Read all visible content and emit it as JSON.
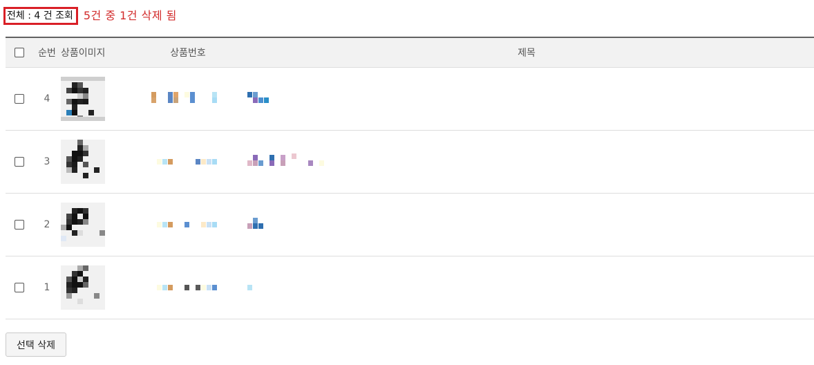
{
  "summary": {
    "total_label": "전체 : 4 건 조회",
    "delete_notice": "5건 중 1건 삭제 됨"
  },
  "table": {
    "headers": {
      "checkbox": "",
      "seq": "순번",
      "image": "상품이미지",
      "product_no": "상품번호",
      "title": "제목"
    },
    "rows": [
      {
        "seq": "4",
        "product_no": "",
        "title": ""
      },
      {
        "seq": "3",
        "product_no": "",
        "title": ""
      },
      {
        "seq": "2",
        "product_no": "",
        "title": ""
      },
      {
        "seq": "1",
        "product_no": "",
        "title": ""
      }
    ]
  },
  "actions": {
    "delete_selected_label": "선택 삭제"
  },
  "colors": {
    "accent_red": "#d91f26",
    "header_bg": "#f2f2f2",
    "table_top_border": "#616161"
  }
}
